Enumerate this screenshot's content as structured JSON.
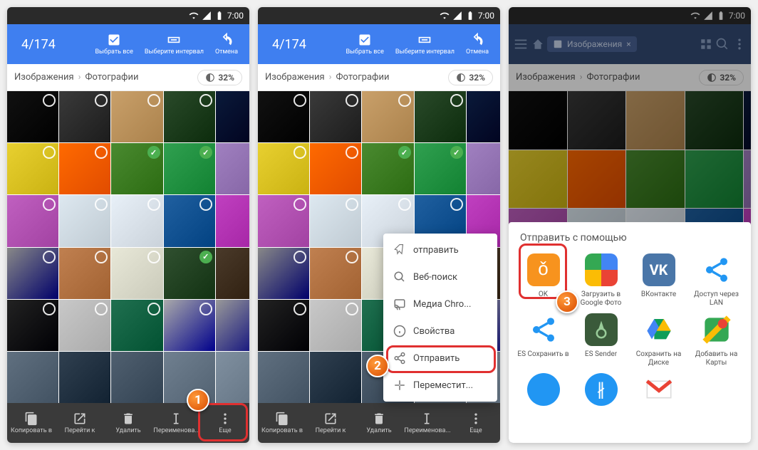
{
  "status": {
    "time": "7:00"
  },
  "selection": {
    "count": "4/174"
  },
  "toolbar": {
    "selectAll": "Выбрать все",
    "interval": "Выберите интервал",
    "cancel": "Отмена"
  },
  "breadcrumb": {
    "p1": "Изображения",
    "p2": "Фотографии",
    "storage": "32%"
  },
  "bottom": {
    "copy": "Копировать в",
    "goto": "Перейти к",
    "delete": "Удалить",
    "rename": "Переименова...",
    "more": "Еще"
  },
  "popup": {
    "send": "отправить",
    "websearch": "Веб-поиск",
    "cast": "Медиа Chro...",
    "props": "Свойства",
    "share": "Отправить",
    "move": "Переместит..."
  },
  "share": {
    "title": "Отправить с помощью",
    "ok": "OK",
    "gphotos": "Загрузить в Google Фото",
    "vk": "ВКонтакте",
    "lan": "Доступ через LAN",
    "essave": "ES Сохранить в",
    "essender": "ES Sender",
    "gdrive": "Сохранить на Диске",
    "gmaps": "Добавить на Карты"
  },
  "tab": {
    "label": "Изображения"
  },
  "thumbs": {
    "colors": [
      [
        "#111",
        "#3a3a3a",
        "#c9a06a",
        "#2a4a2a",
        "#0a1a3a"
      ],
      [
        "#e8d030",
        "#ff6a00",
        "#4a8a30",
        "#30a050",
        "#a080c0"
      ],
      [
        "#c060c0",
        "#dde8f0",
        "#e8f0f8",
        "#2060a0",
        "#c040c0"
      ],
      [
        "#888",
        "#c08050",
        "#e8e8d8",
        "#305030",
        "#4a3a2a"
      ],
      [
        "#222",
        "#c8c8c8",
        "#207050",
        "#aaa",
        "#999"
      ],
      [
        "#607080",
        "#304050",
        "#506070",
        "#708090",
        "#8090a0"
      ]
    ],
    "selected": [
      [
        false,
        false,
        false,
        false,
        false
      ],
      [
        false,
        false,
        true,
        true,
        true
      ],
      [
        false,
        false,
        false,
        false,
        false
      ],
      [
        false,
        false,
        false,
        true,
        false
      ],
      [
        false,
        false,
        false,
        false,
        false
      ],
      [
        false,
        false,
        false,
        false,
        false
      ]
    ]
  }
}
